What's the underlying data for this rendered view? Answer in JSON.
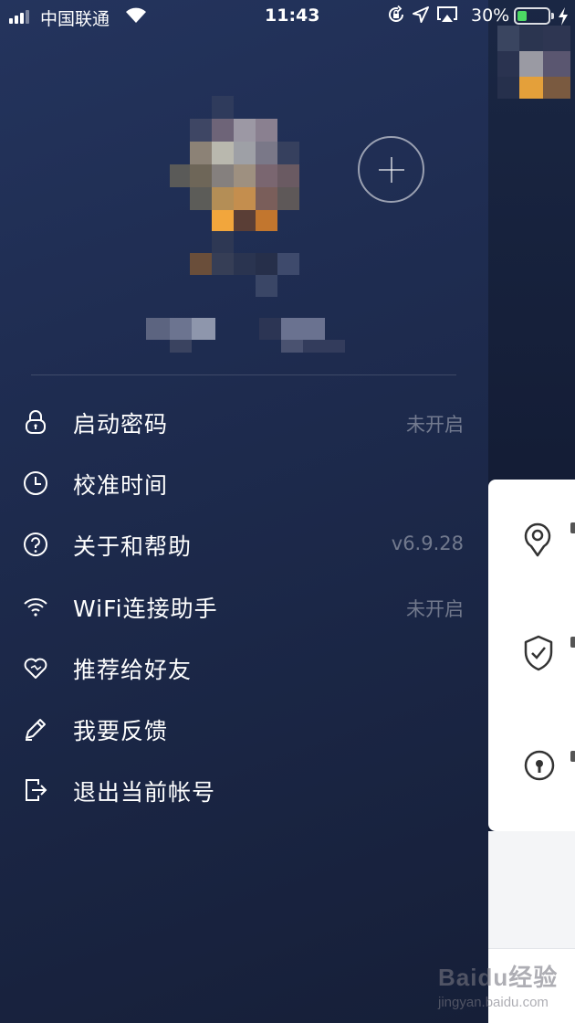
{
  "status_bar": {
    "carrier": "中国联通",
    "time": "11:43",
    "battery_percent": "30%",
    "battery_level": 0.3,
    "signal_bars": 3,
    "icons": [
      "signal-icon",
      "wifi-icon",
      "rotation-lock-icon",
      "location-arrow-icon",
      "airplay-icon",
      "battery-icon",
      "charging-bolt-icon"
    ]
  },
  "profile": {
    "avatar_pixelated": true,
    "add_icon": "plus-circle-icon"
  },
  "menu": {
    "items": [
      {
        "icon": "lock-icon",
        "label": "启动密码",
        "value": "未开启"
      },
      {
        "icon": "clock-icon",
        "label": "校准时间",
        "value": ""
      },
      {
        "icon": "help-circle-icon",
        "label": "关于和帮助",
        "value": "v6.9.28"
      },
      {
        "icon": "wifi-icon",
        "label": "WiFi连接助手",
        "value": "未开启"
      },
      {
        "icon": "heart-icon",
        "label": "推荐给好友",
        "value": ""
      },
      {
        "icon": "pen-icon",
        "label": "我要反馈",
        "value": ""
      },
      {
        "icon": "logout-icon",
        "label": "退出当前帐号",
        "value": ""
      }
    ]
  },
  "background_screen": {
    "icons": [
      "location-pin-icon",
      "shield-check-icon",
      "keyhole-icon"
    ]
  },
  "watermark": {
    "brand": "Baidu经验",
    "url": "jingyan.baidu.com"
  },
  "colors": {
    "drawer_bg": "#1f2d52",
    "text_primary": "#ffffff",
    "text_secondary": "#8a93a8",
    "battery_green": "#4cd964"
  }
}
